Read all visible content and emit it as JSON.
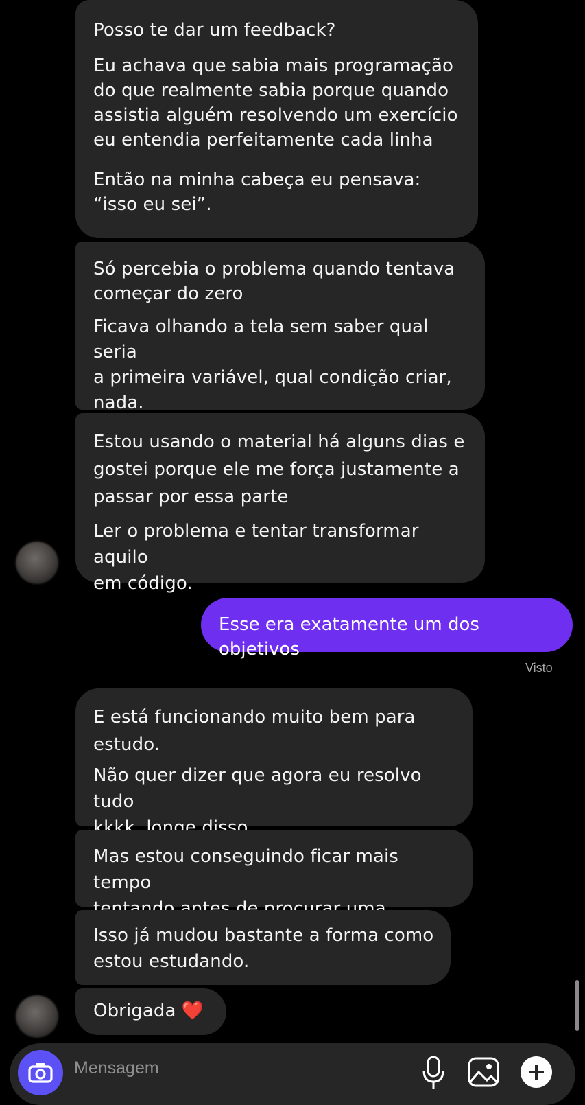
{
  "thread": {
    "group1": [
      {
        "paragraphs": [
          "Posso te dar um feedback?",
          "Eu achava que sabia mais programação\ndo que realmente sabia porque quando\nassistia alguém resolvendo um exercício\neu entendia perfeitamente cada linha",
          "Então na minha cabeça eu pensava:\n“isso eu sei”."
        ]
      },
      {
        "paragraphs": [
          "Só percebia o problema quando tentava\ncomeçar do zero",
          "Ficava olhando a tela sem saber qual seria\na primeira variável, qual condição criar,\nnada."
        ]
      },
      {
        "paragraphs": [
          "Estou usando o material há alguns dias e\ngostei porque ele me força justamente a\npassar por essa parte",
          "Ler o problema e tentar transformar aquilo\nem código."
        ]
      }
    ],
    "sent_message": "Esse era exatamente um dos objetivos",
    "seen_label": "Visto",
    "group2": [
      {
        "paragraphs": [
          "E está funcionando muito bem para\nestudo.",
          "Não quer dizer que agora eu resolvo tudo\nkkkk, longe disso"
        ]
      },
      {
        "paragraphs": [
          "Mas estou conseguindo ficar mais tempo\ntentando antes de procurar uma solução"
        ]
      },
      {
        "paragraphs": [
          "Isso já mudou bastante a forma como\nestou estudando."
        ]
      },
      {
        "paragraphs": [
          "Obrigada ❤️"
        ]
      }
    ]
  },
  "composer": {
    "placeholder": "Mensagem",
    "icons": [
      "camera-icon",
      "microphone-icon",
      "gallery-icon",
      "add-icon"
    ]
  },
  "colors": {
    "background": "#000000",
    "received_bubble": "#262626",
    "sent_bubble": "#6f2ff0",
    "camera_button": "#5b51f5"
  }
}
